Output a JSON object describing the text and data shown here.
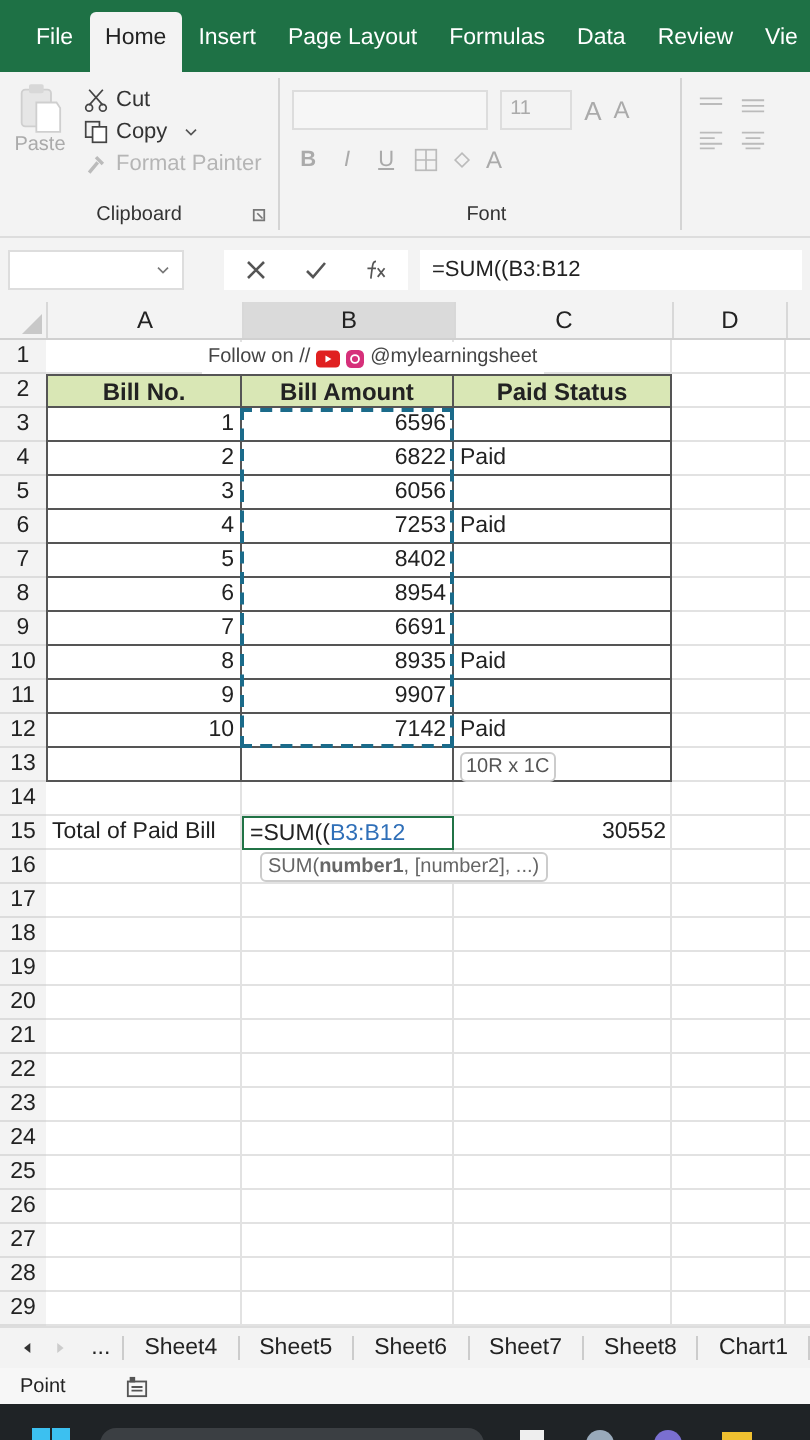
{
  "ribbon": {
    "tabs": [
      {
        "label": "File",
        "selected": false
      },
      {
        "label": "Home",
        "selected": true
      },
      {
        "label": "Insert",
        "selected": false
      },
      {
        "label": "Page Layout",
        "selected": false
      },
      {
        "label": "Formulas",
        "selected": false
      },
      {
        "label": "Data",
        "selected": false
      },
      {
        "label": "Review",
        "selected": false
      },
      {
        "label": "Vie",
        "selected": false
      }
    ],
    "clipboard": {
      "paste": {
        "label": "Paste",
        "disabled": true
      },
      "items": [
        {
          "kind": "cut",
          "label": "Cut",
          "disabled": false
        },
        {
          "kind": "copy",
          "label": "Copy",
          "disabled": false
        },
        {
          "kind": "painter",
          "label": "Format Painter",
          "disabled": true
        }
      ],
      "label": "Clipboard"
    },
    "font": {
      "size": "11",
      "size_buttons": [
        "A",
        "A"
      ],
      "style_buttons": [
        "B",
        "I",
        "U"
      ],
      "color_button": "A",
      "label": "Font"
    }
  },
  "formula_bar": {
    "value": "=SUM((B3:B12"
  },
  "grid": {
    "columns": [
      "A",
      "B",
      "C",
      "D"
    ],
    "row_numbers": [
      "1",
      "2",
      "3",
      "4",
      "5",
      "6",
      "7",
      "8",
      "9",
      "10",
      "11",
      "12",
      "13",
      "14",
      "15",
      "16",
      "17",
      "18",
      "19",
      "20",
      "21",
      "22",
      "23",
      "24",
      "25",
      "26",
      "27",
      "28",
      "29"
    ],
    "banner": {
      "prefix": "Follow on //",
      "handle": "@mylearningsheet"
    },
    "headers": [
      "Bill No.",
      "Bill Amount",
      "Paid Status"
    ],
    "rows": [
      {
        "no": "1",
        "amount": "6596"
      },
      {
        "no": "2",
        "amount": "6822",
        "status": "Paid"
      },
      {
        "no": "3",
        "amount": "6056"
      },
      {
        "no": "4",
        "amount": "7253",
        "status": "Paid"
      },
      {
        "no": "5",
        "amount": "8402"
      },
      {
        "no": "6",
        "amount": "8954"
      },
      {
        "no": "7",
        "amount": "6691"
      },
      {
        "no": "8",
        "amount": "8935",
        "status": "Paid"
      },
      {
        "no": "9",
        "amount": "9907"
      },
      {
        "no": "10",
        "amount": "7142",
        "status": "Paid"
      }
    ],
    "total": {
      "label": "Total of Paid Bill",
      "formula": {
        "fn": "=SUM((",
        "ref": "B3:B12"
      },
      "value": "30552"
    },
    "range_tip": "10R x 1C",
    "hint": "SUM(**number1**, [number2], ...)"
  },
  "sheet_tabs": [
    "...",
    "Sheet4",
    "Sheet5",
    "Sheet6",
    "Sheet7",
    "Sheet8",
    "Chart1"
  ],
  "status_bar": {
    "mode": "Point"
  }
}
